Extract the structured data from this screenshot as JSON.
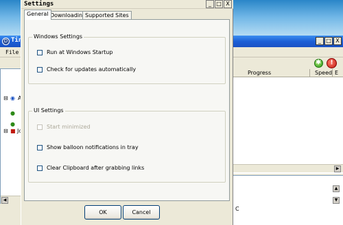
{
  "main_window": {
    "title": "Tin",
    "app_icon": "D",
    "controls": [
      "_",
      "□",
      "X"
    ],
    "menu": {
      "file": "File"
    },
    "toolbar": {
      "start_icon": "green-gear-icon",
      "stop_icon": "red-power-icon",
      "stop_glyph": "!"
    },
    "tree": {
      "expander_1": "⊟",
      "root_label": "A",
      "expander_2": "⊟",
      "child_label": "Jc"
    },
    "columns": {
      "progress": "Progress",
      "speed": "Speed",
      "extra": "E"
    },
    "scroll": {
      "left": "◀",
      "right": "▶",
      "up": "▲",
      "down": "▼"
    },
    "log_text": "C"
  },
  "dialog": {
    "title": "Settings",
    "controls": {
      "minimize": "_",
      "maximize": "□",
      "close": "X"
    },
    "tabs": [
      "General",
      "Downloading",
      "Supported Sites"
    ],
    "active_tab": 0,
    "windows_settings": {
      "label": "Windows Settings",
      "options": [
        {
          "label": "Run at Windows Startup",
          "checked": false,
          "disabled": false
        },
        {
          "label": "Check for updates automatically",
          "checked": false,
          "disabled": false
        }
      ]
    },
    "ui_settings": {
      "label": "UI Settings",
      "options": [
        {
          "label": "Start minimized",
          "checked": false,
          "disabled": true
        },
        {
          "label": "Show balloon notifications in tray",
          "checked": false,
          "disabled": false
        },
        {
          "label": "Clear Clipboard after grabbing links",
          "checked": false,
          "disabled": false
        }
      ]
    },
    "buttons": {
      "ok": "OK",
      "cancel": "Cancel"
    }
  }
}
